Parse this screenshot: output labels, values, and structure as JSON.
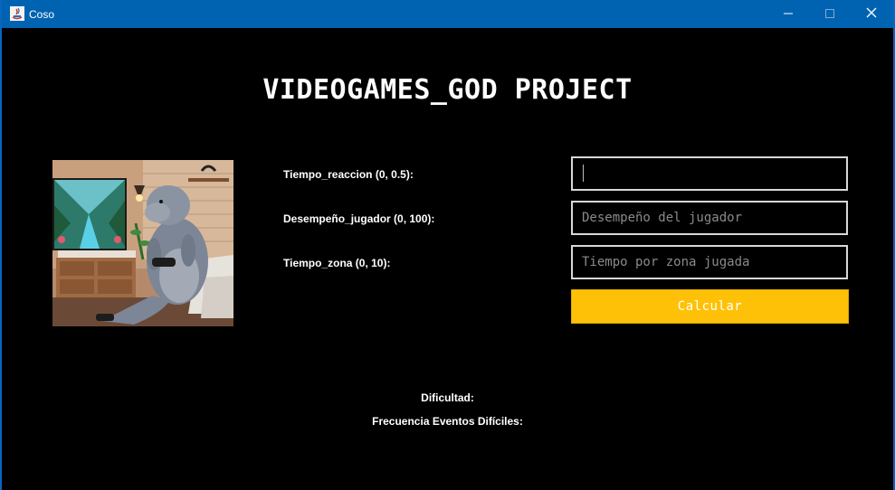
{
  "window": {
    "title": "Coso",
    "icon": "java-app-icon",
    "controls": {
      "minimize_icon": "minimize-icon",
      "maximize_icon": "maximize-icon",
      "close_icon": "close-icon"
    }
  },
  "header": {
    "title": "VIDEOGAMES_GOD PROJECT"
  },
  "image": {
    "description_icon": "manatee-gamer-image"
  },
  "form": {
    "fields": [
      {
        "label": "Tiempo_reaccion (0, 0.5):",
        "value": "",
        "placeholder": ""
      },
      {
        "label": "Desempeño_jugador (0, 100):",
        "value": "",
        "placeholder": "Desempeño del jugador"
      },
      {
        "label": "Tiempo_zona (0, 10):",
        "value": "",
        "placeholder": "Tiempo por zona jugada"
      }
    ],
    "submit_label": "Calcular"
  },
  "results": {
    "difficulty_label": "Dificultad:",
    "frequency_label": "Frecuencia Eventos Difíciles:"
  },
  "colors": {
    "titlebar": "#0063b1",
    "background": "#000000",
    "button": "#ffc107"
  }
}
